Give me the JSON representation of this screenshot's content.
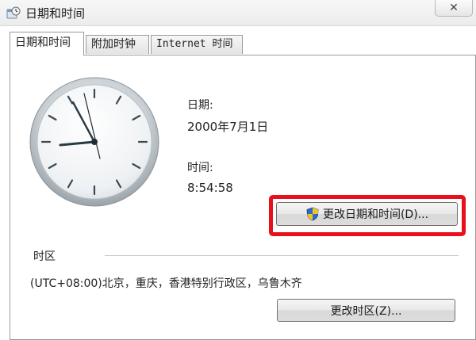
{
  "window": {
    "title": "日期和时间",
    "close_label": "✕"
  },
  "tabs": [
    {
      "label": "日期和时间",
      "active": true
    },
    {
      "label": "附加时钟",
      "active": false
    },
    {
      "label": "Internet 时间",
      "active": false
    }
  ],
  "date": {
    "label": "日期:",
    "value": "2000年7月1日"
  },
  "time": {
    "label": "时间:",
    "value": "8:54:58"
  },
  "change_datetime_button": {
    "label": "更改日期和时间(D)..."
  },
  "timezone": {
    "section_label": "时区",
    "value": "(UTC+08:00)北京，重庆，香港特别行政区，乌鲁木齐",
    "change_button_label": "更改时区(Z)..."
  },
  "colors": {
    "highlight": "#e8101b",
    "clock_hands": "#2a3a44",
    "second_hand": "#1f2a33"
  }
}
